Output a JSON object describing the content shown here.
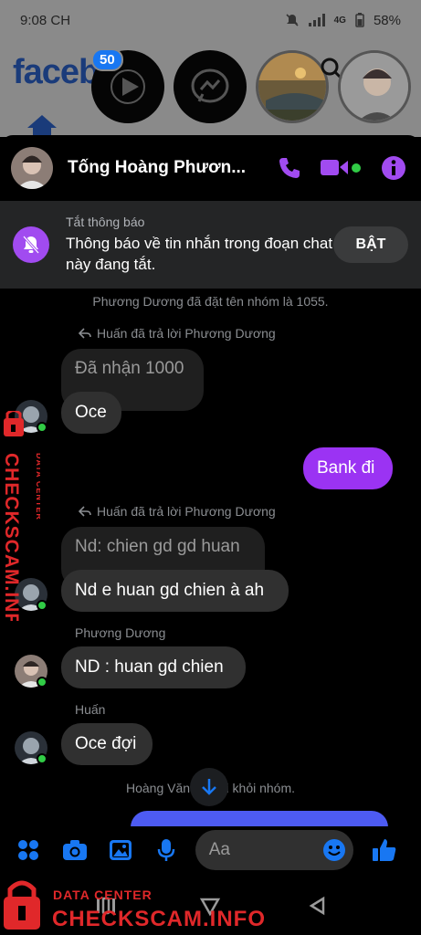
{
  "status_bar": {
    "time": "9:08 CH",
    "signal": "4G",
    "battery": "58%"
  },
  "background": {
    "logo_text": "faceb",
    "notification_badge": "50"
  },
  "header": {
    "contact_name": "Tống Hoàng Phươn...",
    "icons": [
      "phone-icon",
      "video-camera-icon",
      "info-icon"
    ],
    "accent_color": "#a14bf0"
  },
  "mute_banner": {
    "title": "Tắt thông báo",
    "body": "Thông báo về tin nhắn trong đoạn chat này đang tắt.",
    "button_label": "BẬT"
  },
  "messages": {
    "system_rename": "Phương Dương đã đặt tên nhóm là 1055.",
    "reply_note_1": "Huấn đã trả lời Phương Dương",
    "quoted_1": "Đã nhận 1000",
    "reply_1": "Oce",
    "outgoing_1": "Bank đi",
    "reply_note_2": "Huấn đã trả lời Phương Dương",
    "quoted_2": "Nd: chien gd gd huan",
    "reply_2": "Nd e huan gd chien à ah",
    "sender_phuong": "Phương Dương",
    "msg_phuong": "ND : huan gd chien",
    "sender_huan": "Huấn",
    "msg_huan": "Oce đợi",
    "system_left": "Hoàng Văn Hu   rời khỏi nhóm."
  },
  "composer": {
    "placeholder": "Aa",
    "icons": [
      "apps-icon",
      "camera-icon",
      "image-icon",
      "microphone-icon",
      "emoji-icon",
      "thumbs-up-icon"
    ]
  },
  "watermark": {
    "label_top": "DATA CENTER",
    "label_main": "CHECKSCAM.INFO"
  },
  "colors": {
    "outgoing_bubble": "#9b33f3",
    "incoming_bubble": "#303030",
    "blue_icons": "#1877f2",
    "online_dot": "#31cc46"
  }
}
